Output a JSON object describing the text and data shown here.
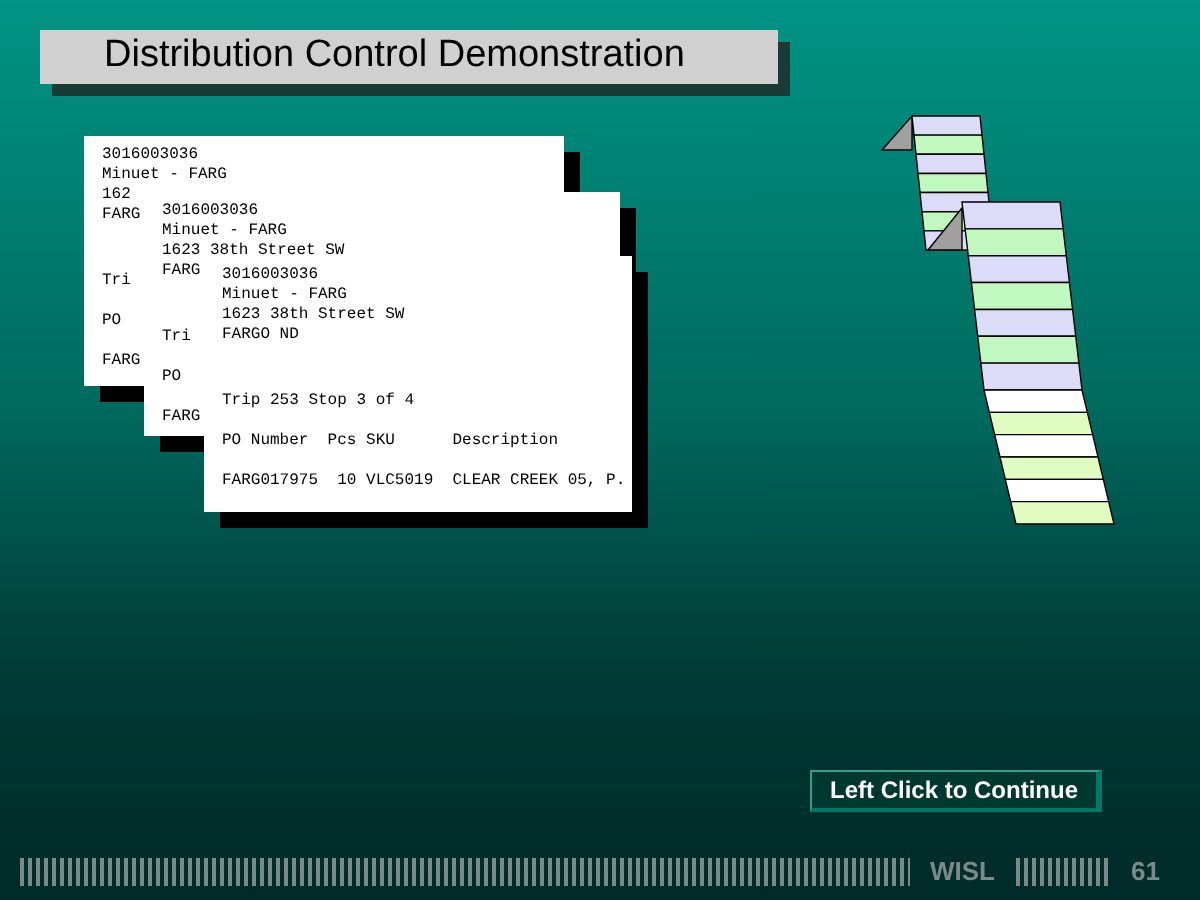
{
  "title": "Distribution Control Demonstration",
  "documents": [
    {
      "lines": [
        "3016003036",
        "Minuet - FARG",
        "162",
        "FARG"
      ],
      "trip": "Tri",
      "header": "PO",
      "item": "FARG"
    },
    {
      "lines": [
        "3016003036",
        "Minuet - FARG",
        "1623 38th Street SW",
        "FARG"
      ],
      "trip": "Tri",
      "header": "PO",
      "item": "FARG"
    },
    {
      "lines": [
        "3016003036",
        "Minuet - FARG",
        "1623 38th Street SW",
        "FARGO ND"
      ],
      "trip": "Trip 253 Stop 3 of 4",
      "header": "PO Number  Pcs SKU      Description",
      "item": "FARG017975  10 VLC5019  CLEAR CREEK 05, P."
    }
  ],
  "continue_button": "Left Click to Continue",
  "footer": {
    "brand": "WISL",
    "page": "61"
  }
}
